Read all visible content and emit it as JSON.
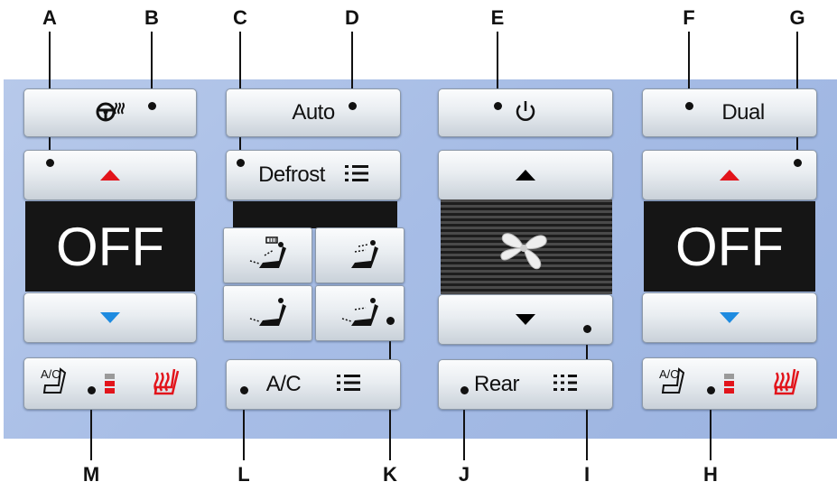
{
  "callouts": {
    "a": "A",
    "b": "B",
    "c": "C",
    "d": "D",
    "e": "E",
    "f": "F",
    "g": "G",
    "h": "H",
    "i": "I",
    "j": "J",
    "k": "K",
    "l": "L",
    "m": "M"
  },
  "buttons": {
    "auto": "Auto",
    "dual": "Dual",
    "defrost": "Defrost",
    "ac": "A/C",
    "rear": "Rear",
    "seat_ac_label": "A/C"
  },
  "displays": {
    "left_temp": "OFF",
    "right_temp": "OFF"
  },
  "icons": {
    "heated_wheel": "heated-steering-wheel-icon",
    "power": "power-icon",
    "fan": "fan-icon",
    "menu": "menu-icon",
    "heated_seat": "heated-seat-icon",
    "cooled_seat": "cooled-seat-icon",
    "airflow": "airflow-mode-icon"
  },
  "colors": {
    "up_arrow_temp": "#e2141b",
    "down_arrow_temp": "#1e8be0",
    "fan_arrows": "#000000",
    "seat_heat": "#e2141b",
    "level_on": "#e2141b",
    "level_off": "#9a9a9a"
  }
}
